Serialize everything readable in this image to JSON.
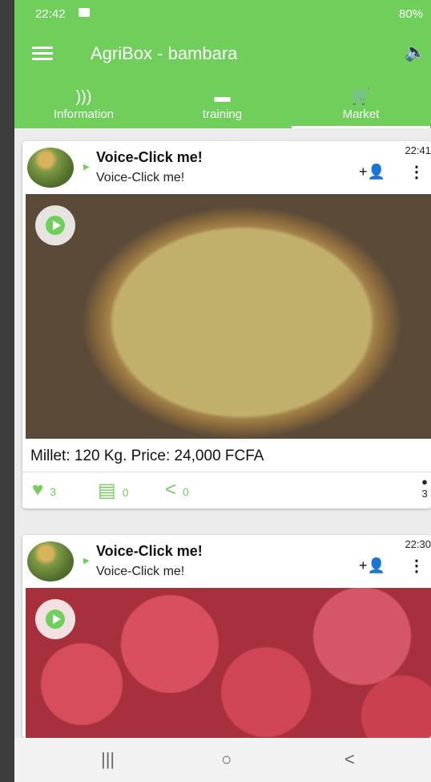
{
  "status": {
    "time": "22:42",
    "right": "80%"
  },
  "appbar": {
    "title": "AgriBox - bambara"
  },
  "tabs": [
    {
      "label": "Information",
      "icon": "rss-icon"
    },
    {
      "label": "training",
      "icon": "chat-icon"
    },
    {
      "label": "Market",
      "icon": "cart-icon"
    }
  ],
  "posts": [
    {
      "title": "Voice-Click me!",
      "subtitle": "Voice-Click me!",
      "time": "22:41",
      "caption": "Millet: 120 Kg. Price: 24,000 FCFA",
      "likes": "3",
      "comments": "0",
      "shares": "0",
      "views": "3"
    },
    {
      "title": "Voice-Click me!",
      "subtitle": "Voice-Click me!",
      "time": "22:30"
    }
  ],
  "navbar": {
    "recent": "|||",
    "home": "○",
    "back": "<"
  }
}
